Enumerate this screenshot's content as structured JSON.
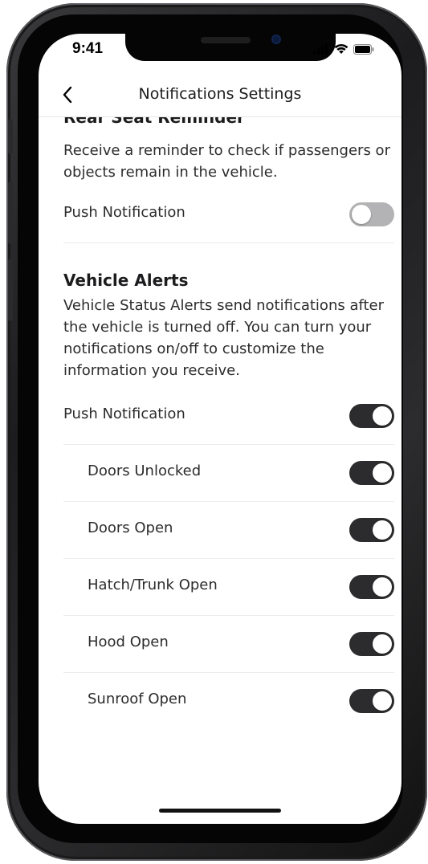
{
  "status_bar": {
    "time": "9:41",
    "icons": [
      "signal-icon",
      "wifi-icon",
      "battery-icon"
    ]
  },
  "nav": {
    "back_icon": "chevron-left-icon",
    "title": "Notifications Settings"
  },
  "rear_seat": {
    "title_partial": "Rear Seat Reminder",
    "description": "Receive a reminder to check if passengers or objects remain in the vehicle.",
    "push_label": "Push Notification",
    "push_enabled": false
  },
  "vehicle_alerts": {
    "title": "Vehicle Alerts",
    "description": "Vehicle Status Alerts send notifications after the vehicle is turned off. You can turn your notifications on/off to customize the information you receive.",
    "push_label": "Push Notification",
    "push_enabled": true,
    "items": [
      {
        "label": "Doors Unlocked",
        "enabled": true
      },
      {
        "label": "Doors Open",
        "enabled": true
      },
      {
        "label": "Hatch/Trunk Open",
        "enabled": true
      },
      {
        "label": "Hood Open",
        "enabled": true
      },
      {
        "label": "Sunroof Open",
        "enabled": true
      }
    ]
  },
  "colors": {
    "toggle_on": "#2c2c2e",
    "toggle_off": "#b3b3b5",
    "text": "#2c2c2e"
  }
}
